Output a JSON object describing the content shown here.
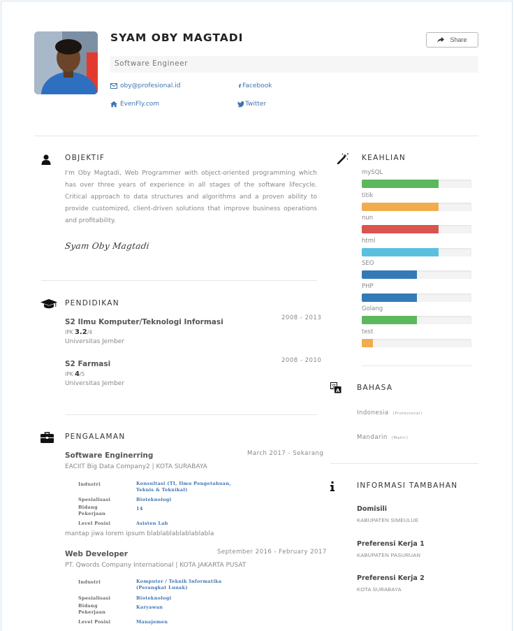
{
  "profile": {
    "name": "SYAM OBY MAGTADI",
    "title": "Software Engineer",
    "share_label": "Share",
    "email": "oby@profesional.id",
    "website": "EvenFly.com",
    "facebook": "Facebook",
    "twitter": "Twitter"
  },
  "objective": {
    "heading": "OBJEKTIF",
    "text": "I'm Oby Magtadi, Web Programmer with object-oriented programming which has over three years of experience in all stages of the software lifecycle. Critical approach to data structures and algorithms and a proven ability to provide customized, client-driven solutions that improve business operations and profitability.",
    "signature": "Syam Oby Magtadi"
  },
  "education": {
    "heading": "PENDIDIKAN",
    "items": [
      {
        "degree": "S2 Ilmu Komputer/Teknologi Informasi",
        "years": "2008 - 2013",
        "ipk_label": "IPK",
        "ipk": "3.2",
        "ipk_max": "/4",
        "school": "Universitas Jember"
      },
      {
        "degree": "S2 Farmasi",
        "years": "2008 - 2010",
        "ipk_label": "IPK",
        "ipk": "4",
        "ipk_max": "/5",
        "school": "Universitas Jember"
      }
    ]
  },
  "experience": {
    "heading": "PENGALAMAN",
    "items": [
      {
        "role": "Software Enginerring",
        "period": "March 2017 - Sekarang",
        "company": "EACIIT Big Data Company2 | KOTA SURABAYA",
        "details": [
          {
            "label": "Industri",
            "value": "Konsultasi (TI, Ilmu Pengetahuan, Teknis & Teknikal)"
          },
          {
            "label": "Spesialisasi",
            "value": "Bioteknologi"
          },
          {
            "label": "Bidang Pekerjaan",
            "value": "14"
          },
          {
            "label": "Level Posisi",
            "value": "Asisten Lab"
          }
        ],
        "description": "mantap jiwa lorem ipsum blablablablablablabla"
      },
      {
        "role": "Web Developer",
        "period": "September 2016 - February 2017",
        "company": "PT. Qwords Company International | KOTA JAKARTA PUSAT",
        "details": [
          {
            "label": "Industri",
            "value": "Komputer / Teknik Informatika (Perangkat Lunak)"
          },
          {
            "label": "Spesialisasi",
            "value": "Bioteknologi"
          },
          {
            "label": "Bidang Pekerjaan",
            "value": "Karyawan"
          },
          {
            "label": "Level Posisi",
            "value": "Manajemen"
          }
        ]
      }
    ]
  },
  "skills": {
    "heading": "KEAHLIAN",
    "items": [
      {
        "name": "mySQL",
        "level": 0.7,
        "color": "#5cb85c"
      },
      {
        "name": "titik",
        "level": 0.7,
        "color": "#f0ad4e"
      },
      {
        "name": "nun",
        "level": 0.7,
        "color": "#d9534f"
      },
      {
        "name": "html",
        "level": 0.7,
        "color": "#5bc0de"
      },
      {
        "name": "SEO",
        "level": 0.5,
        "color": "#337ab7"
      },
      {
        "name": "PHP",
        "level": 0.5,
        "color": "#337ab7"
      },
      {
        "name": "Golang",
        "level": 0.5,
        "color": "#5cb85c"
      },
      {
        "name": "test",
        "level": 0.1,
        "color": "#f0ad4e"
      }
    ]
  },
  "languages": {
    "heading": "BAHASA",
    "items": [
      {
        "name": "Indonesia",
        "level": "(Profesional)"
      },
      {
        "name": "Mandarin",
        "level": "(Mahir)"
      }
    ]
  },
  "additional": {
    "heading": "INFORMASI TAMBAHAN",
    "items": [
      {
        "title": "Domisili",
        "value": "KABUPATEN SIMEULUE"
      },
      {
        "title": "Preferensi Kerja 1",
        "value": "KABUPATEN PASURUAN"
      },
      {
        "title": "Preferensi Kerja 2",
        "value": "KOTA SURABAYA"
      }
    ]
  },
  "icons": {
    "objective": "user-icon",
    "education": "graduation-cap-icon",
    "experience": "briefcase-icon",
    "skills": "magic-wand-icon",
    "languages": "translate-icon",
    "additional": "info-icon",
    "email": "envelope-icon",
    "website": "home-icon",
    "facebook": "facebook-icon",
    "twitter": "twitter-icon",
    "share": "share-icon"
  }
}
